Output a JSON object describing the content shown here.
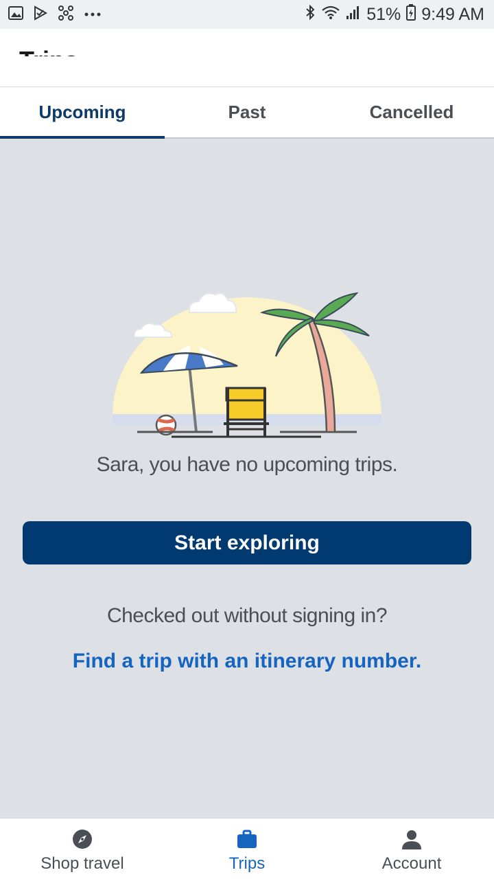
{
  "status_bar": {
    "battery": "51%",
    "time": "9:49 AM",
    "icons_left": [
      "image-icon",
      "check-flag-icon",
      "grid-dots-icon",
      "more-dots-icon"
    ],
    "icons_right": [
      "bluetooth-icon",
      "wifi-icon",
      "signal-icon",
      "battery-icon"
    ]
  },
  "app_bar": {
    "title": "Trips"
  },
  "tabs": [
    {
      "label": "Upcoming",
      "active": true
    },
    {
      "label": "Past",
      "active": false
    },
    {
      "label": "Cancelled",
      "active": false
    }
  ],
  "empty_state": {
    "message": "Sara, you have no upcoming trips.",
    "cta_label": "Start exploring",
    "checked_out_text": "Checked out without signing in?",
    "find_trip_link": "Find a trip with an itinerary number."
  },
  "bottom_nav": [
    {
      "label": "Shop travel",
      "icon": "compass-icon",
      "active": false
    },
    {
      "label": "Trips",
      "icon": "briefcase-icon",
      "active": true
    },
    {
      "label": "Account",
      "icon": "person-icon",
      "active": false
    }
  ],
  "colors": {
    "primary": "#003a70",
    "link": "#1565c0",
    "background": "#dde0e4"
  }
}
